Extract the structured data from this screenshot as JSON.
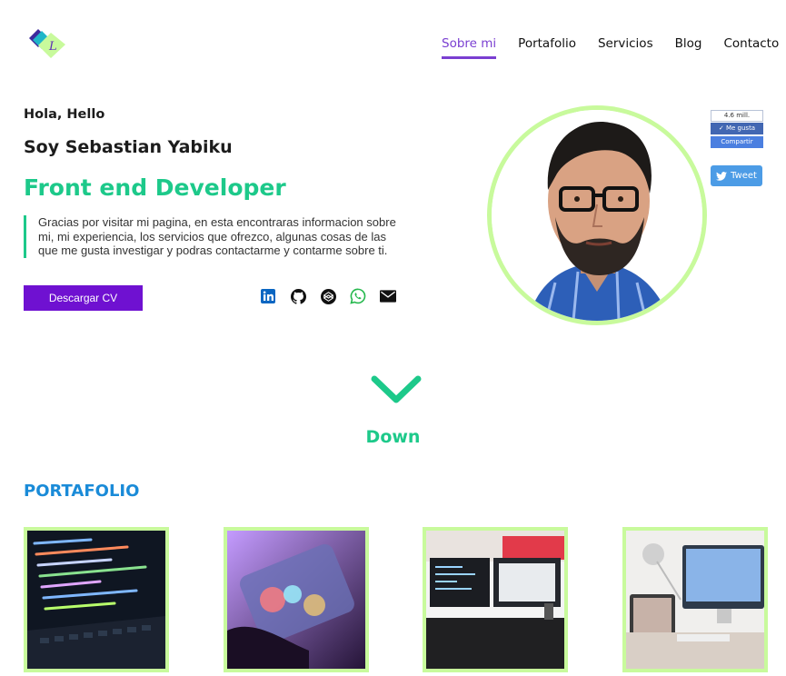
{
  "nav": {
    "items": [
      "Sobre mi",
      "Portafolio",
      "Servicios",
      "Blog",
      "Contacto"
    ],
    "active": "Sobre mi"
  },
  "hero": {
    "greeting": "Hola, Hello",
    "name": "Soy Sebastian Yabiku",
    "role": "Front end Developer",
    "description": "Gracias por visitar mi pagina, en esta encontraras informacion sobre mi, mi experiencia, los servicios que ofrezco, algunas cosas de las que me gusta investigar y podras contactarme y contarme sobre ti.",
    "cv_button": "Descargar CV",
    "social_icons": [
      "linkedin-icon",
      "github-icon",
      "codepen-icon",
      "whatsapp-icon",
      "mail-icon"
    ]
  },
  "share": {
    "fb_count": "4.6 mill.",
    "fb_like": "Me gusta",
    "fb_share": "Compartir",
    "tweet": "Tweet"
  },
  "down": {
    "label": "Down"
  },
  "portfolio": {
    "title": "PORTAFOLIO"
  },
  "colors": {
    "accent_green": "#1dc98a",
    "accent_purple": "#7a3fd1",
    "button_purple": "#6f11d1",
    "ring_lime": "#c8fa9c",
    "portfolio_blue": "#1a8bd8"
  }
}
